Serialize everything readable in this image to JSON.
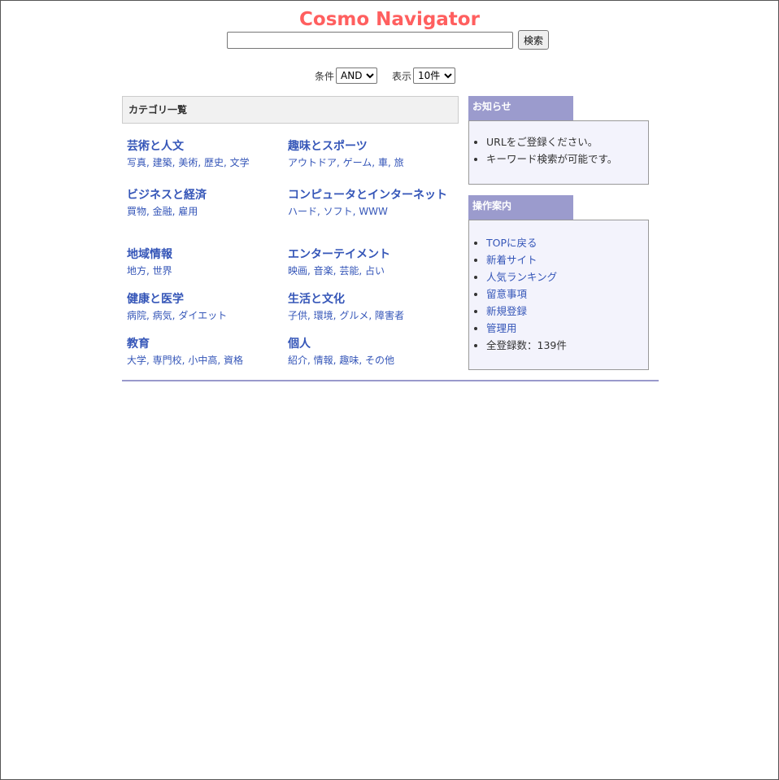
{
  "header": {
    "site_title": "Cosmo Navigator",
    "search_placeholder": "",
    "search_button": "検索",
    "condition_label": "条件",
    "condition_value": "AND",
    "display_label": "表示",
    "display_value": "10件"
  },
  "categories_heading": "カテゴリ一覧",
  "categories": [
    {
      "title": "芸術と人文",
      "subs": [
        "写真",
        "建築",
        "美術",
        "歴史",
        "文学"
      ]
    },
    {
      "title": "趣味とスポーツ",
      "subs": [
        "アウトドア",
        "ゲーム",
        "車",
        "旅"
      ]
    },
    {
      "title": "ビジネスと経済",
      "subs": [
        "買物",
        "金融",
        "雇用"
      ]
    },
    {
      "title": "コンピュータとインターネット",
      "subs": [
        "ハード",
        "ソフト",
        "WWW"
      ]
    },
    {
      "title": "地域情報",
      "subs": [
        "地方",
        "世界"
      ]
    },
    {
      "title": "エンターテイメント",
      "subs": [
        "映画",
        "音楽",
        "芸能",
        "占い"
      ]
    },
    {
      "title": "健康と医学",
      "subs": [
        "病院",
        "病気",
        "ダイエット"
      ]
    },
    {
      "title": "生活と文化",
      "subs": [
        "子供",
        "環境",
        "グルメ",
        "障害者"
      ]
    },
    {
      "title": "教育",
      "subs": [
        "大学",
        "専門校",
        "小中高",
        "資格"
      ]
    },
    {
      "title": "個人",
      "subs": [
        "紹介",
        "情報",
        "趣味",
        "その他"
      ]
    }
  ],
  "notice": {
    "title": "お知らせ",
    "items": [
      "URLをご登録ください。",
      "キーワード検索が可能です。"
    ]
  },
  "guide": {
    "title": "操作案内",
    "links": [
      "TOPに戻る",
      "新着サイト",
      "人気ランキング",
      "留意事項",
      "新規登録",
      "管理用"
    ],
    "total": "全登録数：139件"
  },
  "colors": {
    "title": "#ff5f5f",
    "link": "#3556b8",
    "panel_tab": "#9b9bcd",
    "panel_body": "#f3f3fc"
  }
}
